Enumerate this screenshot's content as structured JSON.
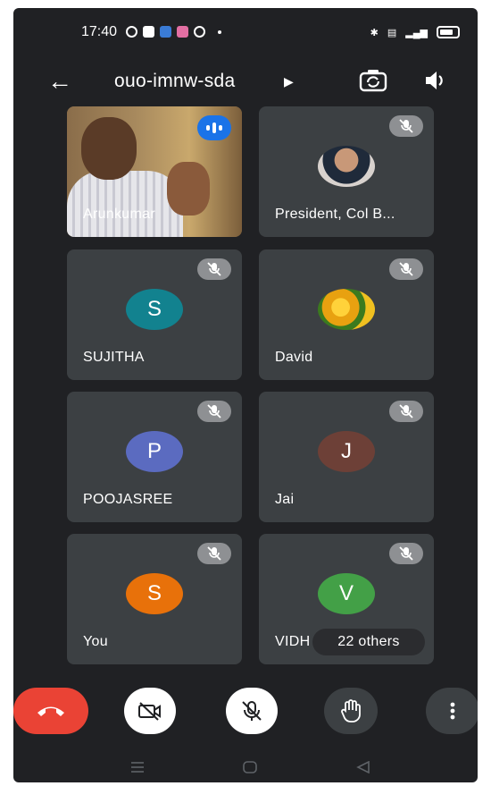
{
  "status_bar": {
    "time": "17:40"
  },
  "top_bar": {
    "meeting_code": "ouo-imnw-sda"
  },
  "participants": [
    {
      "name": "Arunkumar",
      "initial": "",
      "video": true,
      "speaking": true
    },
    {
      "name": "President, Col B...",
      "initial": "",
      "avatar": "photo"
    },
    {
      "name": "SUJITHA",
      "initial": "S",
      "color": "#12828f",
      "muted": true
    },
    {
      "name": "David",
      "initial": "",
      "avatar": "flower-photo",
      "muted": true
    },
    {
      "name": "POOJASREE",
      "initial": "P",
      "color": "#5b6bc0",
      "muted": true
    },
    {
      "name": "Jai",
      "initial": "J",
      "color": "#6d4037",
      "muted": true
    },
    {
      "name": "You",
      "initial": "S",
      "color": "#e8710a",
      "muted": true
    },
    {
      "name": "VIDH",
      "initial": "V",
      "color": "#43a047",
      "muted": true
    }
  ],
  "others_pill": "22 others",
  "controls": {
    "end_call": "end-call-icon",
    "camera": "camera-off-icon",
    "mic": "mic-off-icon",
    "raise_hand": "hand-icon",
    "more": "more-vert-icon"
  },
  "colors": {
    "background": "#202124",
    "tile": "#3c4043",
    "end_call": "#ea4335",
    "speaking": "#1a73e8"
  }
}
